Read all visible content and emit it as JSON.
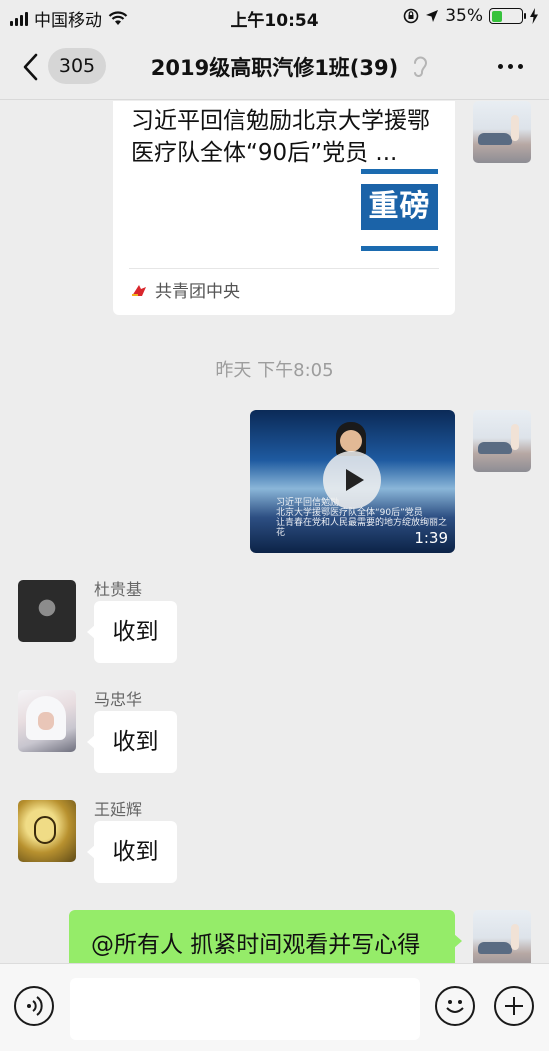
{
  "status_bar": {
    "carrier": "中国移动",
    "time": "上午10:54",
    "battery_percent": "35%",
    "battery_level": 0.35,
    "icons": [
      "signal-icon",
      "wifi-icon",
      "screen-lock-icon",
      "location-icon",
      "battery-icon",
      "charging-icon"
    ]
  },
  "nav": {
    "unread_count": "305",
    "title": "2019级高职汽修1班(39)",
    "icons": [
      "back-chevron-icon",
      "ear-icon",
      "more-icon"
    ]
  },
  "messages": {
    "link_card": {
      "title": "习近平回信勉励北京大学援鄂医疗队全体“90后”党员 ...",
      "thumb_text": "重磅",
      "source": "共青团中央"
    },
    "timestamp": "昨天 下午8:05",
    "video": {
      "duration": "1:39",
      "caption_lines": [
        "习近平回信勉励",
        "北京大学援鄂医疗队全体“90后”党员",
        "让青春在党和人民最需要的地方绽放绚丽之花"
      ]
    },
    "incoming": [
      {
        "sender": "杜贵基",
        "text": "收到"
      },
      {
        "sender": "马忠华",
        "text": "收到"
      },
      {
        "sender": "王延辉",
        "text": "收到"
      }
    ],
    "outgoing_text": "@所有人  抓紧时间观看并写心得"
  },
  "input_bar": {
    "placeholder": "",
    "icons": [
      "voice-icon",
      "emoji-icon",
      "plus-icon"
    ]
  },
  "colors": {
    "background": "#ededed",
    "outgoing_bubble": "#95ec69",
    "incoming_bubble": "#ffffff",
    "battery": "#37c23c",
    "timestamp": "#9d9d9d"
  }
}
